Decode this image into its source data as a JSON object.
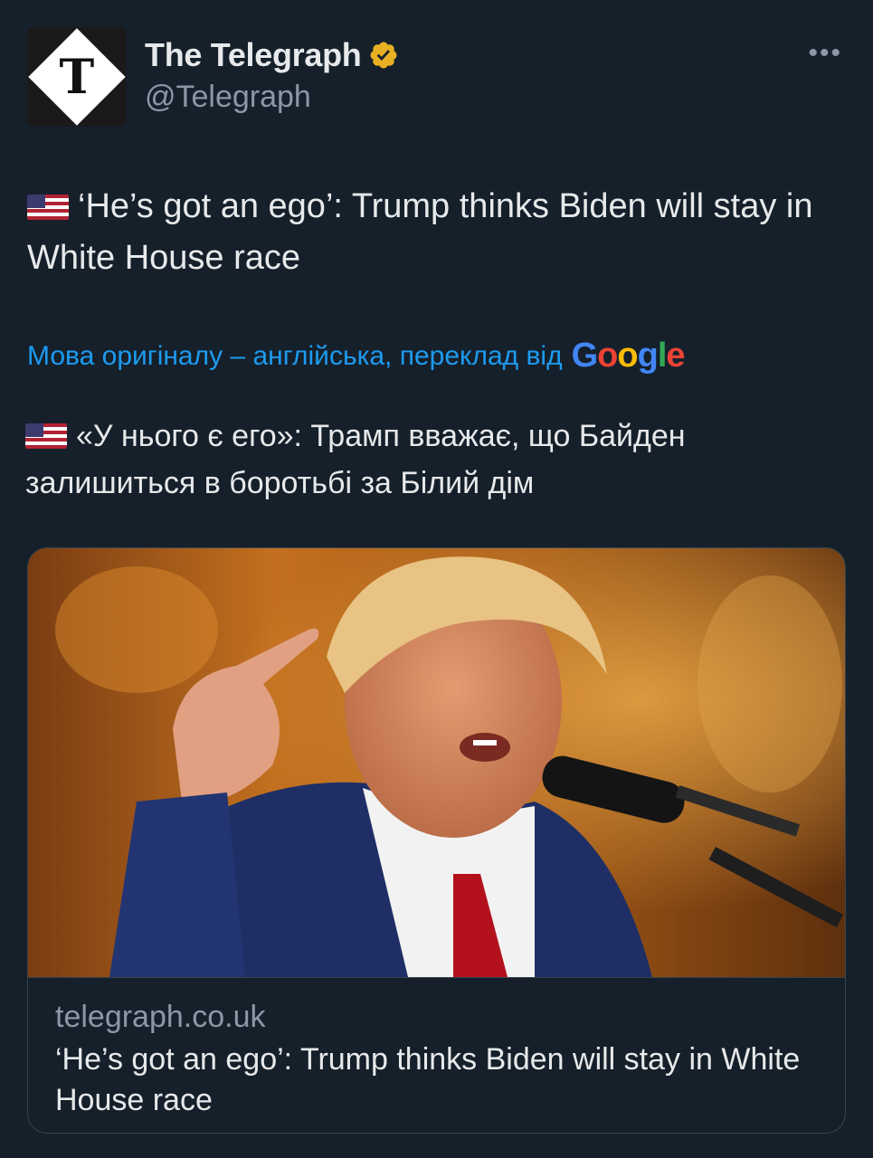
{
  "author": {
    "display_name": "The Telegraph",
    "handle": "@Telegraph",
    "avatar_letter": "T",
    "verified_icon": "verified-badge-icon"
  },
  "more_label": "•••",
  "tweet": {
    "text": "‘He’s got an ego’: Trump thinks Biden will stay in White House race"
  },
  "translation": {
    "note": "Мова оригіналу – англійська, переклад від",
    "provider": "Google",
    "text": "«У нього є его»: Трамп вважає, що Байден залишиться в боротьбі за Білий дім"
  },
  "link_card": {
    "domain": "telegraph.co.uk",
    "title": "‘He’s got an ego’: Trump thinks Biden will stay in White House race"
  },
  "colors": {
    "background": "#15202b",
    "text": "#e7e9ea",
    "secondary": "#8b98a5",
    "link": "#1d9bf0",
    "verified_gold": "#e8b023",
    "border": "#38444d"
  }
}
